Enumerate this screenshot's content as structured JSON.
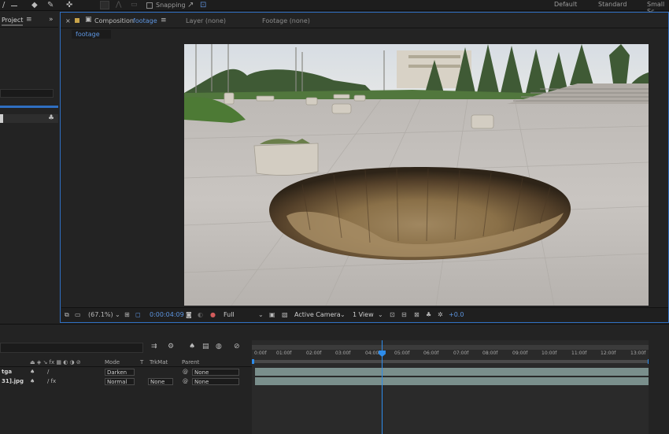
{
  "toolbar": {
    "snapping_label": "Snapping",
    "workspaces": [
      "Default",
      "Standard",
      "Small Sc"
    ]
  },
  "project_panel": {
    "tab_label": "Project"
  },
  "comp_panel": {
    "close": "×",
    "tab_prefix": "Composition",
    "comp_name": "footage",
    "layer_tab": "Layer (none)",
    "footage_tab": "Footage (none)",
    "breadcrumb": "footage"
  },
  "viewer_controls": {
    "zoom": "(67.1%)",
    "timecode": "0:00:04:09",
    "resolution": "Full",
    "camera": "Active Camera",
    "view": "1 View",
    "exposure": "+0.0"
  },
  "timeline": {
    "columns": {
      "mode": "Mode",
      "t": "T",
      "trkmat": "TrkMat",
      "parent": "Parent"
    },
    "layers": [
      {
        "name": "tga",
        "mode": "Darken",
        "trkmat": "",
        "parent": "None"
      },
      {
        "name": "31].jpg",
        "mode": "Normal",
        "trkmat": "None",
        "parent": "None"
      }
    ],
    "ruler": [
      "0:00f",
      "01:00f",
      "02:00f",
      "03:00f",
      "04:00f",
      "05:00f",
      "06:00f",
      "07:00f",
      "08:00f",
      "09:00f",
      "10:00f",
      "11:00f",
      "12:00f",
      "13:00f",
      "14"
    ],
    "playhead_time": "04:09"
  },
  "colors": {
    "accent": "#2f6fc2",
    "playhead": "#2d8ceb",
    "clip": "#7a8f8c",
    "panel": "#232323"
  }
}
